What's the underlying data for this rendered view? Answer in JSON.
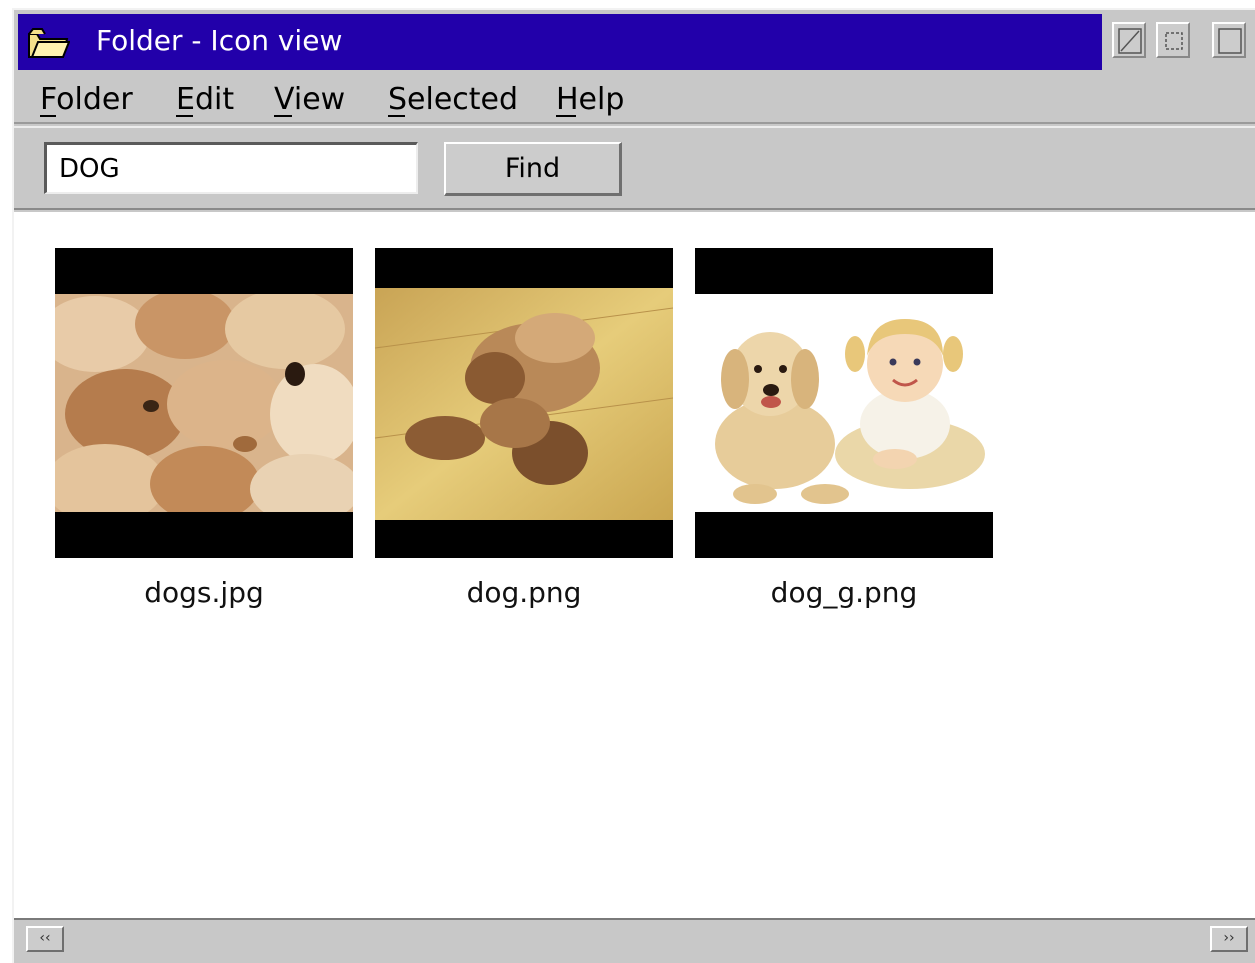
{
  "window": {
    "title": "Folder - Icon view"
  },
  "menu": {
    "items": [
      {
        "label": "Folder",
        "mnemonic": "F"
      },
      {
        "label": "Edit",
        "mnemonic": "E"
      },
      {
        "label": "View",
        "mnemonic": "V"
      },
      {
        "label": "Selected",
        "mnemonic": "S"
      },
      {
        "label": "Help",
        "mnemonic": "H"
      }
    ]
  },
  "toolbar": {
    "search_value": "DOG",
    "find_label": "Find"
  },
  "files": [
    {
      "name": "dogs.jpg",
      "thumbnail": "puppies-pile"
    },
    {
      "name": "dog.png",
      "thumbnail": "puppy-on-floor"
    },
    {
      "name": "dog_g.png",
      "thumbnail": "dog-and-girl"
    }
  ],
  "colors": {
    "titlebar": "#2200aa",
    "window_bg": "#c8c8c8",
    "content_bg": "#ffffff"
  },
  "icons": {
    "title": "folder-icon",
    "minimize": "minimize-icon",
    "maximize": "maximize-icon",
    "close": "close-icon",
    "scroll_left": "scroll-left-icon",
    "scroll_right": "scroll-right-icon"
  }
}
